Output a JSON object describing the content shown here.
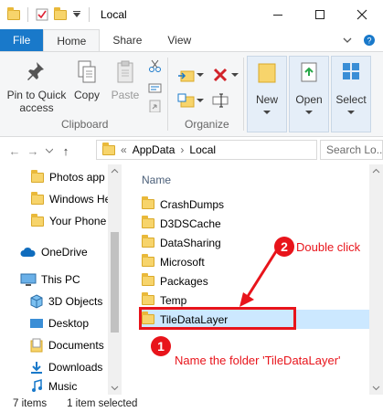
{
  "window": {
    "title": "Local",
    "controls": [
      "minimize-icon",
      "maximize-icon",
      "close-icon"
    ]
  },
  "ribbon_tabs": [
    {
      "label": "File"
    },
    {
      "label": "Home"
    },
    {
      "label": "Share"
    },
    {
      "label": "View"
    }
  ],
  "ribbon": {
    "clipboard": {
      "group_label": "Clipboard",
      "pin_label": "Pin to Quick access",
      "copy_label": "Copy",
      "paste_label": "Paste"
    },
    "organize": {
      "group_label": "Organize"
    },
    "new_label": "New",
    "open_label": "Open",
    "select_label": "Select"
  },
  "address": {
    "overflow": "«",
    "crumbs": [
      "AppData",
      "Local"
    ],
    "search_placeholder": "Search Lo..."
  },
  "nav_pane": {
    "items": [
      {
        "label": "Photos app",
        "icon": "folder-icon"
      },
      {
        "label": "Windows He",
        "icon": "folder-icon"
      },
      {
        "label": "Your Phone",
        "icon": "folder-icon"
      },
      {
        "label": "OneDrive",
        "icon": "cloud-icon"
      },
      {
        "label": "This PC",
        "icon": "computer-icon"
      },
      {
        "label": "3D Objects",
        "icon": "cube-icon"
      },
      {
        "label": "Desktop",
        "icon": "desktop-icon"
      },
      {
        "label": "Documents",
        "icon": "documents-icon"
      },
      {
        "label": "Downloads",
        "icon": "download-icon"
      },
      {
        "label": "Music",
        "icon": "music-icon"
      }
    ]
  },
  "content": {
    "column_header": "Name",
    "items": [
      {
        "name": "CrashDumps"
      },
      {
        "name": "D3DSCache"
      },
      {
        "name": "DataSharing"
      },
      {
        "name": "Microsoft"
      },
      {
        "name": "Packages"
      },
      {
        "name": "Temp"
      },
      {
        "name": "TileDataLayer",
        "selected": true
      }
    ]
  },
  "status_bar": {
    "item_count": "7 items",
    "selection": "1 item selected"
  },
  "annotations": {
    "step1_number": "1",
    "step1_text": "Name the folder 'TileDataLayer'",
    "step2_number": "2",
    "step2_text": "Double click",
    "color": "#e8141b"
  }
}
